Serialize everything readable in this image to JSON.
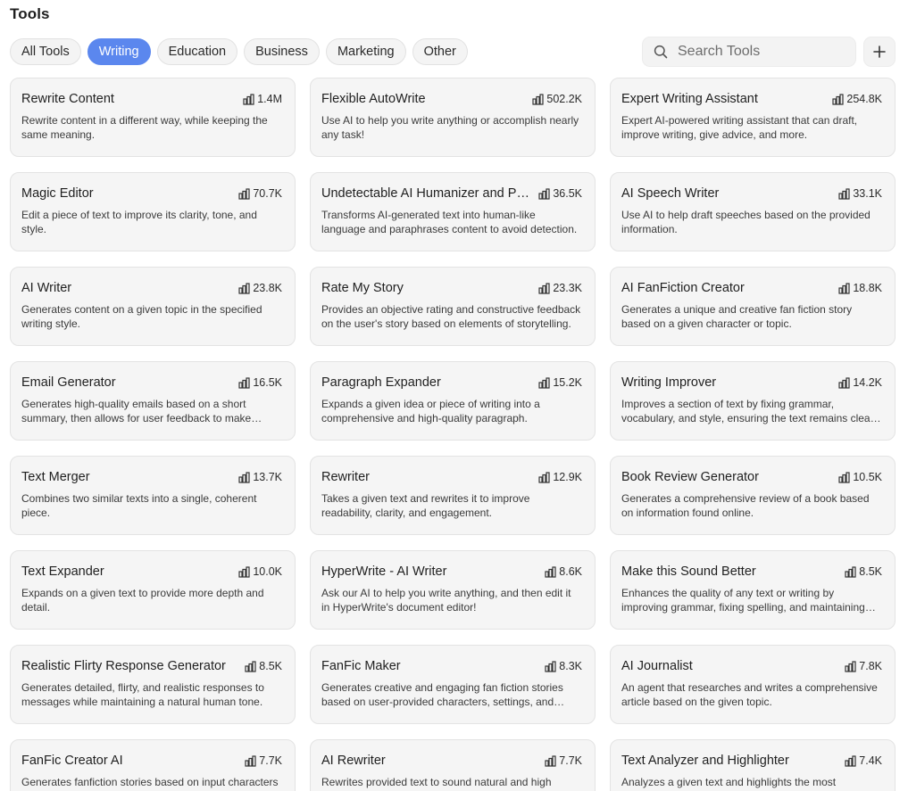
{
  "page": {
    "title": "Tools"
  },
  "filters": [
    {
      "label": "All Tools",
      "active": false
    },
    {
      "label": "Writing",
      "active": true
    },
    {
      "label": "Education",
      "active": false
    },
    {
      "label": "Business",
      "active": false
    },
    {
      "label": "Marketing",
      "active": false
    },
    {
      "label": "Other",
      "active": false
    }
  ],
  "search": {
    "placeholder": "Search Tools",
    "value": "",
    "icon": "search-icon"
  },
  "add_button": {
    "icon": "plus-icon"
  },
  "colors": {
    "accent": "#5b87ee",
    "card_bg": "#f5f5f5",
    "card_border": "#e3e3e3"
  },
  "tools": [
    {
      "title": "Rewrite Content",
      "count": "1.4M",
      "description": "Rewrite content in a different way, while keeping the same meaning."
    },
    {
      "title": "Flexible AutoWrite",
      "count": "502.2K",
      "description": "Use AI to help you write anything or accomplish nearly any task!"
    },
    {
      "title": "Expert Writing Assistant",
      "count": "254.8K",
      "description": "Expert AI-powered writing assistant that can draft, improve writing, give advice, and more."
    },
    {
      "title": "Magic Editor",
      "count": "70.7K",
      "description": "Edit a piece of text to improve its clarity, tone, and style."
    },
    {
      "title": "Undetectable AI Humanizer and Paraphraser",
      "count": "36.5K",
      "description": "Transforms AI-generated text into human-like language and paraphrases content to avoid detection."
    },
    {
      "title": "AI Speech Writer",
      "count": "33.1K",
      "description": "Use AI to help draft speeches based on the provided information."
    },
    {
      "title": "AI Writer",
      "count": "23.8K",
      "description": "Generates content on a given topic in the specified writing style."
    },
    {
      "title": "Rate My Story",
      "count": "23.3K",
      "description": "Provides an objective rating and constructive feedback on the user's story based on elements of storytelling."
    },
    {
      "title": "AI FanFiction Creator",
      "count": "18.8K",
      "description": "Generates a unique and creative fan fiction story based on a given character or topic."
    },
    {
      "title": "Email Generator",
      "count": "16.5K",
      "description": "Generates high-quality emails based on a short summary, then allows for user feedback to make improvements."
    },
    {
      "title": "Paragraph Expander",
      "count": "15.2K",
      "description": "Expands a given idea or piece of writing into a comprehensive and high-quality paragraph."
    },
    {
      "title": "Writing Improver",
      "count": "14.2K",
      "description": "Improves a section of text by fixing grammar, vocabulary, and style, ensuring the text remains clear and concise."
    },
    {
      "title": "Text Merger",
      "count": "13.7K",
      "description": "Combines two similar texts into a single, coherent piece."
    },
    {
      "title": "Rewriter",
      "count": "12.9K",
      "description": "Takes a given text and rewrites it to improve readability, clarity, and engagement."
    },
    {
      "title": "Book Review Generator",
      "count": "10.5K",
      "description": "Generates a comprehensive review of a book based on information found online."
    },
    {
      "title": "Text Expander",
      "count": "10.0K",
      "description": "Expands on a given text to provide more depth and detail."
    },
    {
      "title": "HyperWrite - AI Writer",
      "count": "8.6K",
      "description": "Ask our AI to help you write anything, and then edit it in HyperWrite's document editor!"
    },
    {
      "title": "Make this Sound Better",
      "count": "8.5K",
      "description": "Enhances the quality of any text or writing by improving grammar, fixing spelling, and maintaining the original meaning."
    },
    {
      "title": "Realistic Flirty Response Generator",
      "count": "8.5K",
      "description": "Generates detailed, flirty, and realistic responses to messages while maintaining a natural human tone."
    },
    {
      "title": "FanFic Maker",
      "count": "8.3K",
      "description": "Generates creative and engaging fan fiction stories based on user-provided characters, settings, and plots."
    },
    {
      "title": "AI Journalist",
      "count": "7.8K",
      "description": "An agent that researches and writes a comprehensive article based on the given topic."
    },
    {
      "title": "FanFic Creator AI",
      "count": "7.7K",
      "description": "Generates fanfiction stories based on input characters and settings."
    },
    {
      "title": "AI Rewriter",
      "count": "7.7K",
      "description": "Rewrites provided text to sound natural and high quality."
    },
    {
      "title": "Text Analyzer and Highlighter",
      "count": "7.4K",
      "description": "Analyzes a given text and highlights the most important information."
    }
  ]
}
